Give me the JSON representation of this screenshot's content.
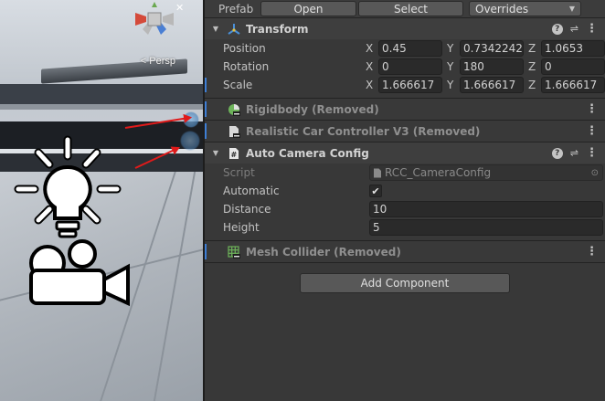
{
  "scene": {
    "view_mode_label": "< Persp"
  },
  "prefab_bar": {
    "label": "Prefab",
    "open_label": "Open",
    "select_label": "Select",
    "overrides_label": "Overrides"
  },
  "transform": {
    "title": "Transform",
    "rows": [
      {
        "label": "Position",
        "x": "0.45",
        "y": "0.7342242",
        "z": "1.0653"
      },
      {
        "label": "Rotation",
        "x": "0",
        "y": "180",
        "z": "0"
      },
      {
        "label": "Scale",
        "x": "1.666617",
        "y": "1.666617",
        "z": "1.666617"
      }
    ],
    "axis_labels": [
      "X",
      "Y",
      "Z"
    ]
  },
  "removed_components": [
    {
      "title": "Rigidbody (Removed)",
      "icon": "rigidbody-icon"
    },
    {
      "title": "Realistic Car Controller V3 (Removed)",
      "icon": "script-removed-icon"
    },
    {
      "title": "Mesh Collider (Removed)",
      "icon": "mesh-collider-icon"
    }
  ],
  "auto_camera_config": {
    "title": "Auto Camera Config",
    "script_label": "Script",
    "script_value": "RCC_CameraConfig",
    "automatic_label": "Automatic",
    "automatic_checked": true,
    "distance_label": "Distance",
    "distance_value": "10",
    "height_label": "Height",
    "height_value": "5"
  },
  "add_component_label": "Add Component",
  "colors": {
    "panel_bg": "#383838",
    "field_bg": "#2a2a2a",
    "removed_marker": "#3e7fd6",
    "annotation_arrow": "#e01a1a"
  }
}
